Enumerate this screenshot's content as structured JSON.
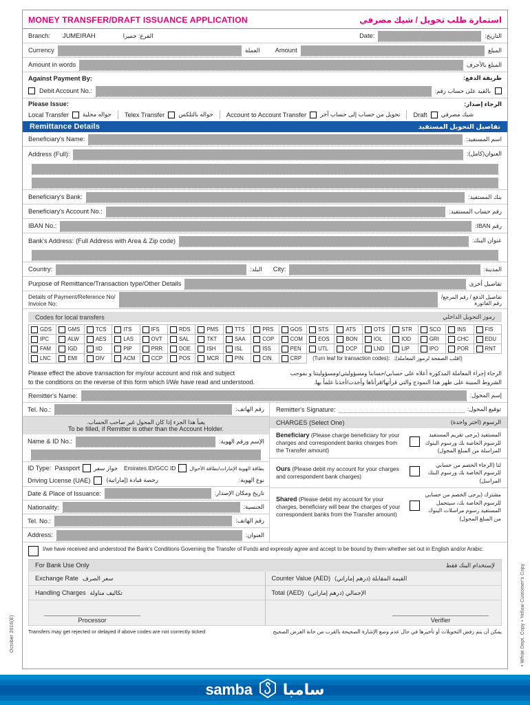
{
  "margins": {
    "left": "October 2016(E)",
    "right": "• White Dept. Copy  • Yellow Customer's Copy"
  },
  "header": {
    "title_en": "MONEY TRANSFER/DRAFT ISSUANCE APPLICATION",
    "title_ar": "استمارة طلب تحويل / شيك مصرفي",
    "accent_color": "#e5007d"
  },
  "top": {
    "branch_label_en": "Branch:",
    "branch_value": "JUMEIRAH",
    "branch_label_ar": "الفرع:   جميرا",
    "date_label_en": "Date:",
    "date_label_ar": "التاريخ:",
    "currency_label_en": "Currency",
    "currency_label_ar": "العملة",
    "amount_label_en": "Amount",
    "amount_label_ar": "المبلغ",
    "words_label_en": "Amount in words",
    "words_label_ar": "المبلغ بالأحرف",
    "against_label_en": "Against Payment By:",
    "against_label_ar": "طريقة الدفع:",
    "debit_label_en": "Debit Account No.:",
    "debit_label_ar": "بالقيد على حساب رقم:",
    "issue_label_en": "Please Issue:",
    "issue_label_ar": "الرجاء إصدار:"
  },
  "issue_options": [
    {
      "en": "Local Transfer",
      "ar": "حواله محلية"
    },
    {
      "en": "Telex Transfer",
      "ar": "حواله بالتلكس"
    },
    {
      "en": "Account to Account Transfer",
      "ar": "تحويل من حساب إلى حساب آخر"
    },
    {
      "en": "Draft",
      "ar": "شيك مصرفي"
    }
  ],
  "remittance": {
    "bar_en": "Remittance Details",
    "bar_ar": "تفاصيل التحويل المستفيد",
    "bar_color": "#1659a8",
    "rows": [
      {
        "en": "Beneficiary's Name:",
        "ar": "اسم المستفيد:"
      },
      {
        "en": "Address (Full):",
        "ar": "العنوان(كامل):"
      },
      {
        "en": "Beneficiary's Bank:",
        "ar": "بنك المستفيد:"
      },
      {
        "en": "Beneficiary's Account No.:",
        "ar": "رقم حساب المستفيد:"
      },
      {
        "en": "IBAN No.:",
        "ar": "رقم IBAN:"
      },
      {
        "en": "Bank's Address: (Full Address with Area & Zip code)",
        "ar": "عنوان البنك:"
      }
    ],
    "country_en": "Country:",
    "country_ar": "البلد:",
    "city_en": "City:",
    "city_ar": "المدينة:",
    "purpose_en": "Purpose of Remittance/Transaction type/Other Details",
    "purpose_ar": "تفاصيل أخرى",
    "details_en_1": "Details of Payment/Reference No/",
    "details_en_2": "Invoice No:",
    "details_ar_1": "تفاصيل الدفع / رقم المرجع/",
    "details_ar_2": "رقم الفاتورة"
  },
  "codes": {
    "bar_en": "Codes for local transfers",
    "bar_ar": "رموز التحويل الداخلي",
    "note_en": "(Turn leaf for transaction codes):",
    "note_ar": "(اقلب الصفحة لرموز المعاملة):",
    "rows": [
      [
        "GDS",
        "GMS",
        "TCS",
        "ITS",
        "IFS",
        "RDS",
        "PMS",
        "TTS",
        "PRS",
        "GOS",
        "STS",
        "ATS",
        "OTS",
        "STR",
        "SCO",
        "INS",
        "FIS"
      ],
      [
        "IPC",
        "ALW",
        "AES",
        "LAS",
        "OVT",
        "SAL",
        "TKT",
        "SAA",
        "COP",
        "COM",
        "EOS",
        "BON",
        "IOL",
        "IOD",
        "GRI",
        "CHC",
        "EDU"
      ],
      [
        "FAM",
        "IGD",
        "IID",
        "PIP",
        "PRR",
        "DOE",
        "ISH",
        "ISL",
        "ISS",
        "PEN",
        "UTL",
        "DCP",
        "LND",
        "LIP",
        "IPO",
        "POR",
        "RNT"
      ],
      [
        "LNC",
        "EMI",
        "DIV",
        "ACM",
        "CCP",
        "POS",
        "MCR",
        "PIN",
        "CIN",
        "CRP"
      ]
    ]
  },
  "declaration": {
    "en_1": "Please effect the above transaction for my/our account and risk and subject",
    "en_2": "to the conditions on the reverse of this form which I/We have read and understood.",
    "ar_1": "الرجاء إجراء المعاملة المذكورة أعلاه على حسابي/حسابنا ومسؤوليتي/ومسؤوليتنا و بموجب",
    "ar_2": "الشروط المبينة على ظهر هذا النموذج والتي قرأتها/قرأناها وأخذت/أخذنا علماً بها."
  },
  "remitter": {
    "name_en": "Remitter's Name:",
    "name_ar": "إسم المحول:",
    "tel_en": "Tel. No.:",
    "tel_ar": "رقم الهاتف:",
    "signature_en": "Remitter's Signature:",
    "signature_ar": "توقيع المحول:",
    "band_ar": "يعبأ هذا الجزء إذا كان المحول غير صاحب الحساب.",
    "band_en": "To be filled, if Remitter is other than the Account Holder.",
    "fields": [
      {
        "en": "Name & ID No.:",
        "ar": "الإسم ورقم الهوية:"
      },
      {
        "en": "Date & Place of Issuance:",
        "ar": "تاريخ ومكان الإصدار:"
      },
      {
        "en": "Nationality:",
        "ar": "الجنسية:"
      },
      {
        "en": "Tel. No.:",
        "ar": "رقم الهاتف:"
      },
      {
        "en": "Address:",
        "ar": "العنوان:"
      }
    ],
    "idtype_en": "ID Type:",
    "idtype_ar_1": "نوع الهوية:",
    "id_options": [
      {
        "en": "Passport",
        "ar": "جواز سفر"
      },
      {
        "en": "Emirates ID/GCC ID",
        "ar": "بطاقة الهوية الإمارات/بطاقة الأحوال"
      },
      {
        "en": "Driving License (UAE)",
        "ar": "رخصة قيادة (إماراتية)"
      }
    ]
  },
  "charges": {
    "header_en": "CHARGES (Select One)",
    "header_ar": "الرسوم (اختر واحدة)",
    "options": [
      {
        "title": "Beneficiary",
        "en": "(Please charge beneficiary for your charges and correspondent banks charges from the Transfer amount)",
        "ar": "المستفيد (يرجى تقريم المستفيد للرسوم الخاصة بك ورسوم البنوك المراسلة من المبلغ المحول)"
      },
      {
        "title": "Ours",
        "en": "(Please debit my account for your charges and correspondent bank charges)",
        "ar": "لنا (الرجاء الخصم من حسابي للرسوم الخاصة بك ورسوم البنك المراسل)"
      },
      {
        "title": "Shared",
        "en": "(Please debit my account for your charges, beneficiary will bear the charges of your correspondent banks from the Transfer amount)",
        "ar": "مشترك (يرجى الخصم من حسابي للرسوم الخاصة بك، سيتحمل المستفيد رسوم مراسلات البنوك من المبلغ المحول)"
      }
    ]
  },
  "consent": {
    "text": "I/we have received and understood the Bank's Conditions Governing the Transfer of Funds and expressly agree and accept to be bound by them whether set out in English and/or Arabic."
  },
  "bank_use": {
    "title_en": "For Bank Use Only",
    "title_ar": "لإستخدام البنك فقط",
    "exchange_en": "Exchange Rate",
    "exchange_ar": "سعر الصرف",
    "counter_en": "Counter Value (AED)",
    "counter_ar": "القيمة المقابلة (درهم إماراتي)",
    "handling_en": "Handling Charges",
    "handling_ar": "تكاليف مناولة",
    "total_en": "Total (AED)",
    "total_ar": "الإجمالي (درهم إماراتي)",
    "processor": "Processor",
    "verifier": "Verifier"
  },
  "footnote": {
    "en": "Transfers may get rejected or delayed if above codes are not correctly ticked",
    "ar": "يمكن أن يتم رفض التحويلات أو تأخيرها في حال عدم وضع الإشارة الصحيحة بالقرب من خانة الغرض الصحيح"
  },
  "logo": {
    "word_en": "samba",
    "word_ar": "سامبا",
    "color": "#005ba6"
  }
}
